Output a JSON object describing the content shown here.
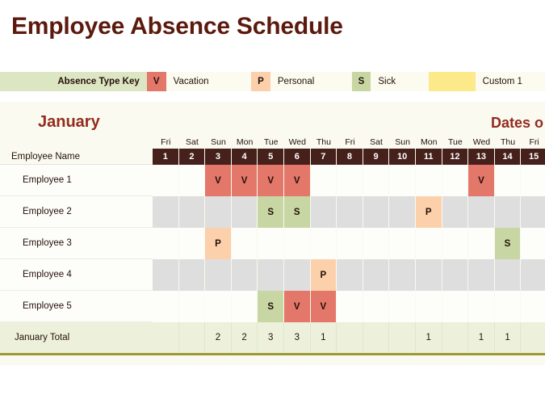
{
  "title": "Employee Absence Schedule",
  "legend": {
    "key_label": "Absence Type Key",
    "items": [
      {
        "code": "V",
        "label": "Vacation",
        "color": "#E3776A"
      },
      {
        "code": "P",
        "label": "Personal",
        "color": "#FBD0AA"
      },
      {
        "code": "S",
        "label": "Sick",
        "color": "#C7D6A2"
      },
      {
        "code": "",
        "label": "Custom 1",
        "color": "#FBE98A"
      }
    ]
  },
  "sheet": {
    "month": "January",
    "dates_header": "Dates o",
    "name_column_header": "Employee Name",
    "total_row_label": "January Total",
    "weekdays": [
      "Fri",
      "Sat",
      "Sun",
      "Mon",
      "Tue",
      "Wed",
      "Thu",
      "Fri",
      "Sat",
      "Sun",
      "Mon",
      "Tue",
      "Wed",
      "Thu",
      "Fri"
    ],
    "dates": [
      "1",
      "2",
      "3",
      "4",
      "5",
      "6",
      "7",
      "8",
      "9",
      "10",
      "11",
      "12",
      "13",
      "14",
      "15"
    ],
    "employees": [
      {
        "name": "Employee 1",
        "banded": false,
        "cells": [
          "",
          "",
          "V",
          "V",
          "V",
          "V",
          "",
          "",
          "",
          "",
          "",
          "",
          "V",
          "",
          ""
        ]
      },
      {
        "name": "Employee 2",
        "banded": true,
        "cells": [
          "",
          "",
          "",
          "",
          "S",
          "S",
          "",
          "",
          "",
          "",
          "P",
          "",
          "",
          "",
          ""
        ]
      },
      {
        "name": "Employee 3",
        "banded": false,
        "cells": [
          "",
          "",
          "P",
          "",
          "",
          "",
          "",
          "",
          "",
          "",
          "",
          "",
          "",
          "S",
          ""
        ]
      },
      {
        "name": "Employee 4",
        "banded": true,
        "cells": [
          "",
          "",
          "",
          "",
          "",
          "",
          "P",
          "",
          "",
          "",
          "",
          "",
          "",
          "",
          ""
        ]
      },
      {
        "name": "Employee 5",
        "banded": false,
        "cells": [
          "",
          "",
          "",
          "",
          "S",
          "V",
          "V",
          "",
          "",
          "",
          "",
          "",
          "",
          "",
          ""
        ]
      }
    ],
    "totals": [
      "",
      "",
      "2",
      "2",
      "3",
      "3",
      "1",
      "",
      "",
      "",
      "1",
      "",
      "1",
      "1",
      ""
    ]
  },
  "colors": {
    "title": "#5C1A0E",
    "month_heading": "#932B1E",
    "date_header_bg": "#46201A",
    "sheet_bg": "#FAFAF0",
    "band_row": "#DEDEDE",
    "total_row_bg": "#EDF1DC",
    "total_row_border": "#9A9A37"
  }
}
